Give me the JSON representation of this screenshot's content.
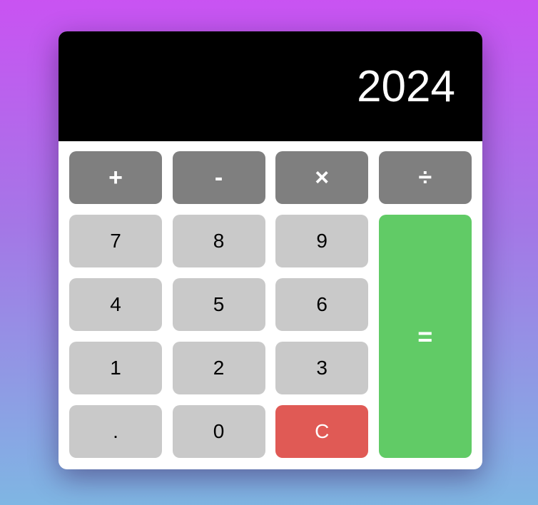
{
  "display": {
    "value": "2024"
  },
  "keys": {
    "add": "+",
    "subtract": "-",
    "multiply": "×",
    "divide": "÷",
    "seven": "7",
    "eight": "8",
    "nine": "9",
    "four": "4",
    "five": "5",
    "six": "6",
    "one": "1",
    "two": "2",
    "three": "3",
    "decimal": ".",
    "zero": "0",
    "clear": "C",
    "equals": "="
  },
  "colors": {
    "display_background": "#000000",
    "operator_key": "#7f7f7f",
    "digit_key": "#c9c9c9",
    "clear_key": "#e05a55",
    "equals_key": "#61cb66"
  }
}
